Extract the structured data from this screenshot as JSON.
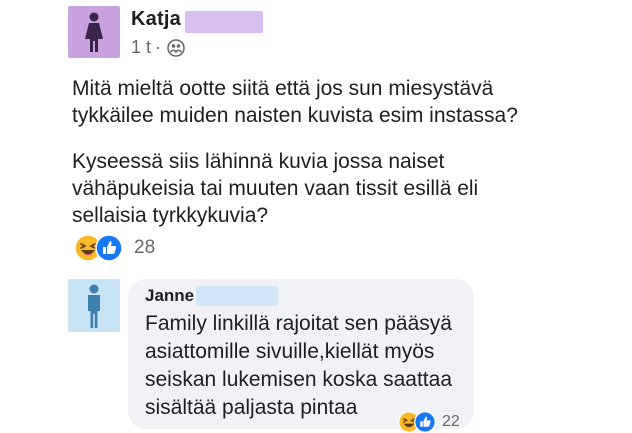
{
  "post": {
    "author": "Katja",
    "time": "1 t",
    "separator": "·",
    "privacy_icon": "friends-icon",
    "paragraph1": "Mitä mieltä ootte siitä että jos sun miesystävä tykkäilee muiden naisten kuvista esim instassa?",
    "paragraph2": "Kyseessä siis lähinnä kuvia jossa naiset vähäpukeisia tai muuten vaan tissit esillä eli sellaisia tyrkkykuvia?",
    "reactions": {
      "icons": [
        "haha-icon",
        "like-icon"
      ],
      "count": "28"
    }
  },
  "comment": {
    "author": "Janne",
    "text": "Family linkillä rajoitat sen pääsyä asiattomille sivuille,kiellät myös seiskan lukemisen koska saattaa sisältää paljasta pintaa",
    "reactions": {
      "icons": [
        "haha-icon",
        "like-icon"
      ],
      "count": "22"
    }
  },
  "colors": {
    "post_avatar_bg": "#c9a3df",
    "comment_avatar_bg": "#c7e3f4",
    "redaction_post": "#d7bff0",
    "redaction_comment": "#cfe7f6",
    "bubble_bg": "#f0f2f5",
    "like_blue": "#1877f2",
    "haha_yellow": "#f7b928",
    "muted_text": "#65676b"
  }
}
